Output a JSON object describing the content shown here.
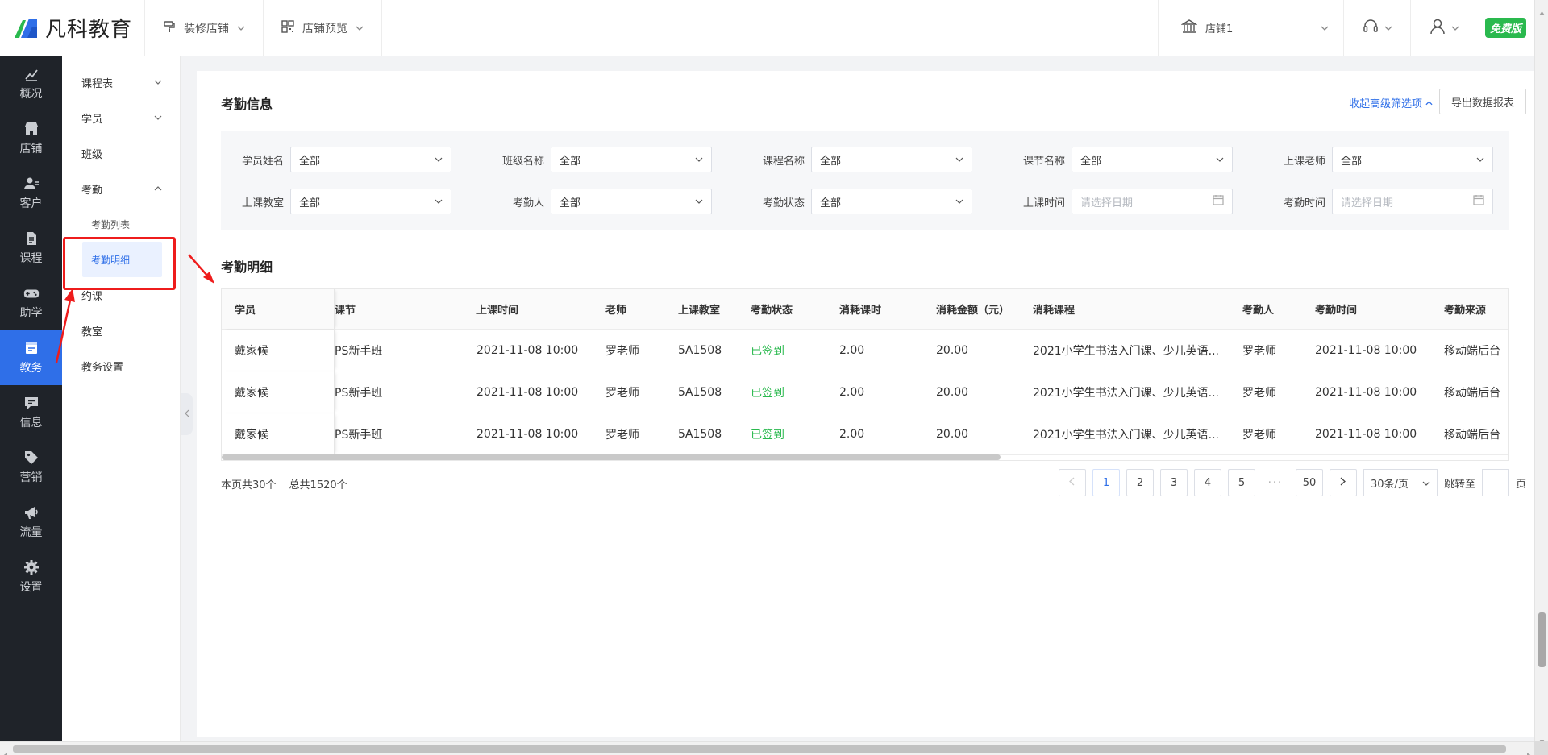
{
  "brand": {
    "name": "凡科教育"
  },
  "top_menu": [
    {
      "label": "装修店铺",
      "icon": "paint-roller-icon"
    },
    {
      "label": "店铺预览",
      "icon": "qrcode-icon"
    }
  ],
  "store": {
    "label": "店铺1",
    "icon": "building-icon"
  },
  "plan_badge": "免费版",
  "left_nav": [
    {
      "label": "概况",
      "icon": "chart-icon"
    },
    {
      "label": "店铺",
      "icon": "shop-icon"
    },
    {
      "label": "客户",
      "icon": "customer-icon"
    },
    {
      "label": "课程",
      "icon": "document-icon"
    },
    {
      "label": "助学",
      "icon": "gamepad-icon"
    },
    {
      "label": "教务",
      "icon": "edu-affairs-icon",
      "active": true
    },
    {
      "label": "信息",
      "icon": "message-icon"
    },
    {
      "label": "营销",
      "icon": "tag-icon"
    },
    {
      "label": "流量",
      "icon": "megaphone-icon"
    },
    {
      "label": "设置",
      "icon": "gear-icon"
    }
  ],
  "sub_menu": {
    "schedule": "课程表",
    "students": "学员",
    "classes": "班级",
    "attendance": "考勤",
    "attendance_list": "考勤列表",
    "attendance_detail": "考勤明细",
    "booking": "约课",
    "classroom": "教室",
    "edu_settings": "教务设置"
  },
  "attendance_info": {
    "title": "考勤信息",
    "collapse_label": "收起高级筛选项",
    "export_label": "导出数据报表"
  },
  "filters": {
    "row1": [
      {
        "label": "学员姓名",
        "value": "全部"
      },
      {
        "label": "班级名称",
        "value": "全部"
      },
      {
        "label": "课程名称",
        "value": "全部"
      },
      {
        "label": "课节名称",
        "value": "全部"
      },
      {
        "label": "上课老师",
        "value": "全部"
      }
    ],
    "row2": [
      {
        "label": "上课教室",
        "value": "全部"
      },
      {
        "label": "考勤人",
        "value": "全部"
      },
      {
        "label": "考勤状态",
        "value": "全部"
      },
      {
        "label": "上课时间",
        "placeholder": "请选择日期"
      },
      {
        "label": "考勤时间",
        "placeholder": "请选择日期"
      }
    ]
  },
  "detail": {
    "title": "考勤明细",
    "columns": [
      "学员",
      "课节",
      "上课时间",
      "老师",
      "上课教室",
      "考勤状态",
      "消耗课时",
      "消耗金额（元）",
      "消耗课程",
      "考勤人",
      "考勤时间",
      "考勤来源"
    ],
    "rows": [
      [
        "戴家候",
        "PS新手班",
        "2021-11-08 10:00",
        "罗老师",
        "5A1508",
        "已签到",
        "2.00",
        "20.00",
        "2021小学生书法入门课、少儿英语...",
        "罗老师",
        "2021-11-08 10:00",
        "移动端后台"
      ],
      [
        "戴家候",
        "PS新手班",
        "2021-11-08 10:00",
        "罗老师",
        "5A1508",
        "已签到",
        "2.00",
        "20.00",
        "2021小学生书法入门课、少儿英语...",
        "罗老师",
        "2021-11-08 10:00",
        "移动端后台"
      ],
      [
        "戴家候",
        "PS新手班",
        "2021-11-08 10:00",
        "罗老师",
        "5A1508",
        "已签到",
        "2.00",
        "20.00",
        "2021小学生书法入门课、少儿英语...",
        "罗老师",
        "2021-11-08 10:00",
        "移动端后台"
      ]
    ]
  },
  "pagination": {
    "page_count_text": "本页共30个",
    "total_text": "总共1520个",
    "pages": [
      "1",
      "2",
      "3",
      "4",
      "5"
    ],
    "ellipsis": "···",
    "last_page": "50",
    "page_size": "30条/页",
    "jump_label": "跳转至",
    "page_suffix": "页"
  },
  "colors": {
    "accent": "#2f6fe8",
    "success": "#2ab94e",
    "nav_bg": "#1f2329",
    "annotation": "#ee1c1c"
  }
}
